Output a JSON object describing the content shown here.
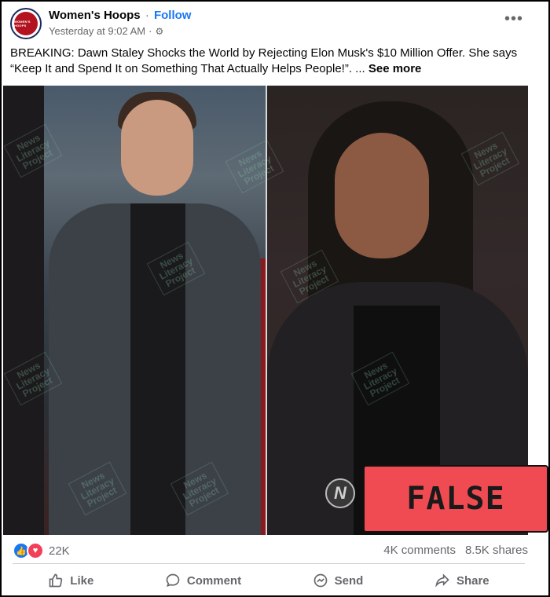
{
  "post": {
    "page_name": "Women's Hoops",
    "separator": "·",
    "follow_label": "Follow",
    "timestamp": "Yesterday at 9:02 AM",
    "meta_separator": "·",
    "caption_line1": "BREAKING: Dawn Staley Shocks the World by Rejecting Elon Musk's $10 Million Offer. She says",
    "caption_line2": "“Keep It and Spend It on Something That Actually Helps People!”. ...",
    "see_more": "See more",
    "avatar_text": "WOMEN'S HOOPS"
  },
  "media": {
    "watermark_text": [
      "News",
      "Literacy",
      "Project"
    ],
    "logo_letter": "N"
  },
  "badge": {
    "label": "FALSE",
    "color": "#f04b52"
  },
  "stats": {
    "reaction_count": "22K",
    "comments": "4K comments",
    "shares": "8.5K shares"
  },
  "actions": {
    "like": "Like",
    "comment": "Comment",
    "send": "Send",
    "share": "Share"
  },
  "colors": {
    "accent": "#1877f2",
    "love": "#f33e58",
    "muted_text": "#65676b"
  },
  "icons": [
    "settings-gear-icon",
    "more-options-icon",
    "like-reaction-icon",
    "love-reaction-icon",
    "thumbs-up-icon",
    "comment-bubble-icon",
    "messenger-send-icon",
    "share-arrow-icon"
  ]
}
